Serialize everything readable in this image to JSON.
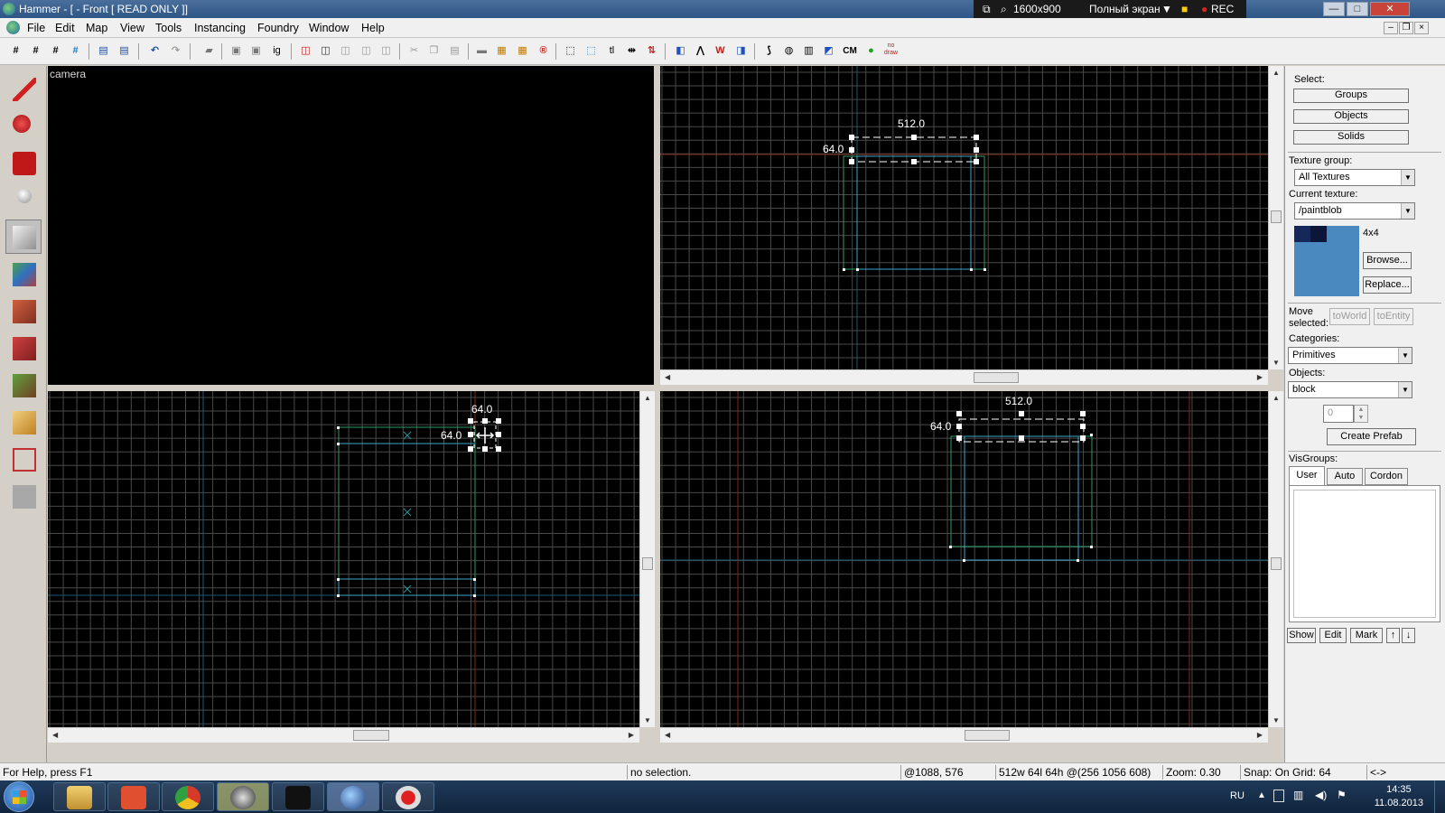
{
  "window": {
    "title": "Hammer - [ - Front [ READ ONLY ]]",
    "recorder": {
      "resolution": "1600x900",
      "mode": "Полный экран",
      "rec": "REC"
    }
  },
  "menu": [
    "File",
    "Edit",
    "Map",
    "View",
    "Tools",
    "Instancing",
    "Foundry",
    "Window",
    "Help"
  ],
  "toolbar_text": {
    "ig": "ig",
    "tl": "tl",
    "cm": "CM",
    "nodraw": "no draw"
  },
  "viewports": {
    "camera": {
      "label": "camera"
    },
    "top_right": {
      "width_label": "512.0",
      "height_label": "64.0"
    },
    "bottom_left": {
      "width_label": "64.0",
      "height_label": "64.0"
    },
    "bottom_right": {
      "width_label": "512.0",
      "height_label": "64.0"
    }
  },
  "panel": {
    "select_label": "Select:",
    "select_buttons": [
      "Groups",
      "Objects",
      "Solids"
    ],
    "texture_group_label": "Texture group:",
    "texture_group_value": "All Textures",
    "current_texture_label": "Current texture:",
    "current_texture_value": "/paintblob",
    "texture_size": "4x4",
    "browse": "Browse...",
    "replace": "Replace...",
    "move_selected_1": "Move",
    "move_selected_2": "selected:",
    "to_world": "toWorld",
    "to_entity": "toEntity",
    "categories_label": "Categories:",
    "categories_value": "Primitives",
    "objects_label": "Objects:",
    "objects_value": "block",
    "spin_value": "0",
    "create_prefab": "Create Prefab",
    "visgroups_label": "VisGroups:",
    "visgroup_tabs": [
      "User",
      "Auto",
      "Cordon"
    ],
    "vis_buttons": [
      "Show",
      "Edit",
      "Mark"
    ]
  },
  "status": {
    "help": "For Help, press F1",
    "selection": "no selection.",
    "coords": "@1088, 576",
    "size": "512w 64l 64h @(256 1056 608)",
    "zoom": "Zoom: 0.30",
    "snap": "Snap: On Grid: 64",
    "arrows": "<->"
  },
  "taskbar": {
    "lang": "RU",
    "time": "14:35",
    "date": "11.08.2013",
    "apps": [
      "explorer",
      "office",
      "chrome",
      "steam",
      "steam-alt",
      "hammer",
      "recorder"
    ]
  },
  "colors": {
    "grid": "#4a4a4a",
    "axis_x": "#7a2a1a",
    "axis_y": "#1a5a7a",
    "brush_cyan": "#3aa6c8",
    "brush_green": "#2a9a6a"
  }
}
